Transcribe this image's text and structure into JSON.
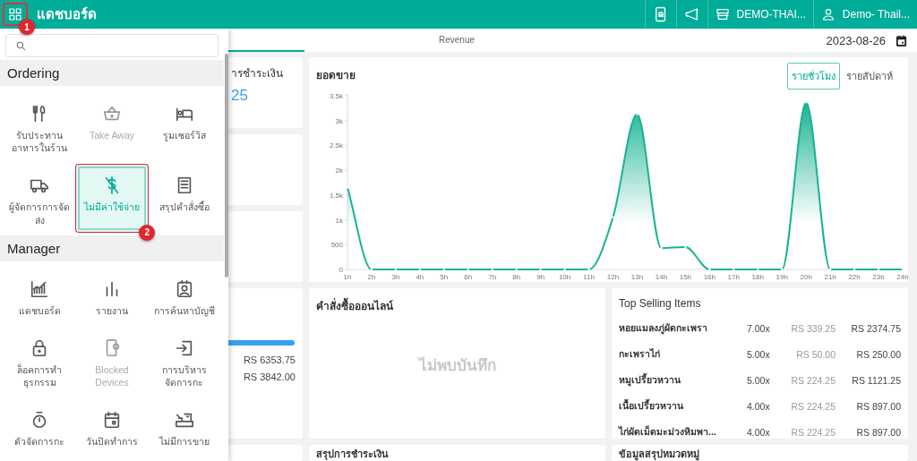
{
  "topbar": {
    "title": "แดชบอร์ด",
    "menu_badge": "1",
    "store": "DEMO-THAI...",
    "user": "Demo- Thail..."
  },
  "menu": {
    "sections": [
      {
        "title": "Ordering",
        "items": [
          {
            "label": "รับประทานอาหารในร้าน",
            "selected": false,
            "disabled": false
          },
          {
            "label": "Take Away",
            "selected": false,
            "disabled": true
          },
          {
            "label": "รูมเซอร์วิส",
            "selected": false,
            "disabled": false
          },
          {
            "label": "ผู้จัดการการจัดส่ง",
            "selected": false,
            "disabled": false
          },
          {
            "label": "ไม่มีค่าใช้จ่าย",
            "selected": true,
            "disabled": false,
            "badge": "2"
          },
          {
            "label": "สรุปคำสั่งซื้อ",
            "selected": false,
            "disabled": false
          }
        ]
      },
      {
        "title": "Manager",
        "items": [
          {
            "label": "แดชบอร์ด",
            "selected": false,
            "disabled": false
          },
          {
            "label": "รายงาน",
            "selected": false,
            "disabled": false
          },
          {
            "label": "การค้นหาบัญชี",
            "selected": false,
            "disabled": false
          },
          {
            "label": "ล็อคการทำธุรกรรม",
            "selected": false,
            "disabled": false
          },
          {
            "label": "Blocked Devices",
            "selected": false,
            "disabled": true
          },
          {
            "label": "การบริหารจัดการกะ",
            "selected": false,
            "disabled": false
          },
          {
            "label": "ตัวจัดการกะ",
            "selected": false,
            "disabled": false
          },
          {
            "label": "วันปิดทำการ",
            "selected": false,
            "disabled": false
          },
          {
            "label": "ไม่มีการขาย",
            "selected": false,
            "disabled": false
          }
        ]
      }
    ]
  },
  "tabs": [
    {
      "selected": true
    },
    {
      "label": "Revenue",
      "selected": false
    }
  ],
  "date": "2023-08-26",
  "left_cards": [
    {
      "kind": "stat",
      "title": "ารชำระเงิน",
      "value": "25"
    },
    {
      "kind": "blank"
    },
    {
      "kind": "blank"
    },
    {
      "kind": "progress",
      "level": 1,
      "amounts": [
        "RS 6353.75",
        "RS 3842.00"
      ]
    },
    {
      "kind": "blank"
    }
  ],
  "sales_chart": {
    "title": "ยอดขาย",
    "toggles": [
      {
        "label": "รายชั่วโมง",
        "selected": true
      },
      {
        "label": "รายสัปดาห์",
        "selected": false
      }
    ],
    "chart_data": {
      "type": "line",
      "categories": [
        "1h",
        "2h",
        "3h",
        "4h",
        "5h",
        "6h",
        "7h",
        "8h",
        "9h",
        "10h",
        "11h",
        "12h",
        "13h",
        "14h",
        "15h",
        "16h",
        "17h",
        "18h",
        "19h",
        "20h",
        "21h",
        "22h",
        "23h",
        "24h"
      ],
      "series": [
        {
          "color": "#1ab394",
          "values": [
            1650,
            0,
            0,
            0,
            0,
            0,
            0,
            0,
            0,
            0,
            0,
            1050,
            3130,
            430,
            450,
            0,
            0,
            0,
            0,
            3370,
            0,
            0,
            0,
            0
          ]
        }
      ],
      "ylim": [
        0,
        3500
      ],
      "yticks": [
        {
          "value": 0,
          "label": "0"
        },
        {
          "value": 500,
          "label": "500"
        },
        {
          "value": 1000,
          "label": "1k"
        },
        {
          "value": 1500,
          "label": "1.5k"
        },
        {
          "value": 2000,
          "label": "2k"
        },
        {
          "value": 2500,
          "label": "2.5k"
        },
        {
          "value": 3000,
          "label": "3k"
        },
        {
          "value": 3500,
          "label": "3.5k"
        }
      ]
    }
  },
  "online_orders": {
    "title": "คำสั่งซื้อออนไลน์",
    "empty": "ไม่พบบันทึก"
  },
  "top_selling": {
    "title": "Top Selling Items",
    "rows": [
      {
        "name": "หอยแมลงภู่ผัดกะเพรา",
        "qty": "7.00x",
        "price": "RS 339.25",
        "total": "RS 2374.75"
      },
      {
        "name": "กะเพราไก่",
        "qty": "5.00x",
        "price": "RS 50.00",
        "total": "RS 250.00"
      },
      {
        "name": "หมูเปรี้ยวหวาน",
        "qty": "5.00x",
        "price": "RS 224.25",
        "total": "RS 1121.25"
      },
      {
        "name": "เนื้อเปรี้ยวหวาน",
        "qty": "4.00x",
        "price": "RS 224.25",
        "total": "RS 897.00"
      },
      {
        "name": "ไก่ผัดเม็ดมะม่วงหิมพา...",
        "qty": "4.00x",
        "price": "RS 224.25",
        "total": "RS 897.00"
      }
    ]
  },
  "bottom_cards": [
    {
      "title": "สรุปการชำระเงิน"
    },
    {
      "title": "ข้อมูลสรุปหมวดหมู่"
    }
  ]
}
